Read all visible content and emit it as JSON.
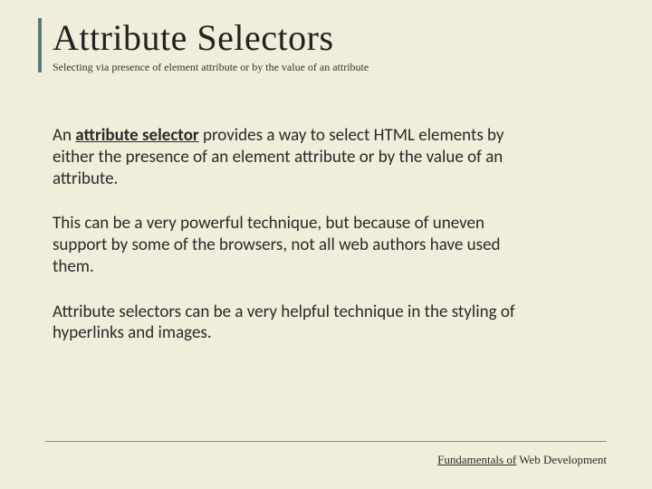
{
  "title": "Attribute Selectors",
  "subtitle": "Selecting via presence of element attribute or by the value of an attribute",
  "para1_a": "An ",
  "para1_b": "attribute selector",
  "para1_c": " provides a way to select HTML elements by either the presence of an element attribute or by the value of an attribute.",
  "para2": "This can be a very powerful technique, but because of uneven support by some of the browsers, not all web authors have used them.",
  "para3": "Attribute selectors can be a very helpful technique in the styling of hyperlinks and images.",
  "footer_a": "Fundamentals ",
  "footer_b": "of",
  "footer_c": " Web Development"
}
